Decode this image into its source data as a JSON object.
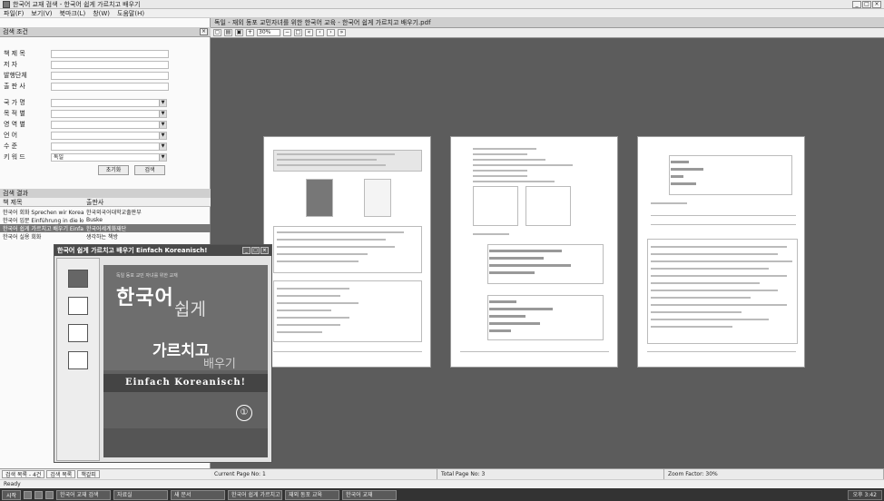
{
  "window": {
    "title": "한국어 교재 검색 - 한국어 쉽게 가르치고 배우기",
    "icon": "app-icon"
  },
  "menu": [
    "파일(F)",
    "보기(V)",
    "북마크(L)",
    "창(W)",
    "도움말(H)"
  ],
  "search_panel": {
    "title": "검색 조건",
    "text_fields": [
      {
        "label": "책 제 목",
        "value": ""
      },
      {
        "label": "저    자",
        "value": ""
      },
      {
        "label": "발행단체",
        "value": ""
      },
      {
        "label": "출 판 사",
        "value": ""
      }
    ],
    "select_fields": [
      {
        "label": "국 가 명",
        "value": ""
      },
      {
        "label": "목 적 별",
        "value": ""
      },
      {
        "label": "영 역 별",
        "value": ""
      },
      {
        "label": "언    어",
        "value": ""
      },
      {
        "label": "수    준",
        "value": ""
      }
    ],
    "keyword": {
      "label": "키 워 드",
      "value": "독일"
    },
    "reset_label": "초기화",
    "search_label": "검색"
  },
  "results_panel": {
    "title": "검색 결과",
    "columns": [
      "책 제목",
      "출판사"
    ],
    "rows": [
      {
        "title": "한국어 회화 Sprechen wir Koreanisch",
        "publisher": "한국외국어대학교출판부"
      },
      {
        "title": "한국어 입문 Einführung in die korea...",
        "publisher": "Buske"
      },
      {
        "title": "한국어 쉽게 가르치고 배우기 Einfach Koreanisch!",
        "publisher": "한국어세계화재단"
      },
      {
        "title": "한국어 실용 회화",
        "publisher": "생각하는 책방"
      }
    ],
    "selected_index": 2
  },
  "bottom_tabs": [
    "검색 목록 - 4건",
    "검색 목록",
    "책갈피"
  ],
  "doc": {
    "tab_title": "독일 - 재외 동포 교민자녀를 위한 한국어 교육 - 한국어 쉽게 가르치고 배우기.pdf",
    "zoom": "30%"
  },
  "status": {
    "current_page": "Current Page No: 1",
    "total_page": "Total Page No: 3",
    "zoom": "Zoom Factor: 30%"
  },
  "ready_text": "Ready",
  "taskbar": {
    "start": "시작",
    "tasks": [
      "한국어 교재 검색",
      "자료실",
      "새 문서",
      "한국어 쉽게 가르치고 배우기",
      "재외 동포 교육",
      "한국어 교재"
    ],
    "clock": "오후 3:42"
  },
  "popup": {
    "title": "한국어 쉽게 가르치고 배우기 Einfach Koreanisch!",
    "cover": {
      "subtitle": "독일 동포 교민 자녀를 위한 교재",
      "line1": "한국어",
      "line2": "쉽게",
      "line3": "가르치고",
      "line4": "배우기",
      "line5": "Einfach Koreanisch!",
      "number": "①"
    }
  }
}
